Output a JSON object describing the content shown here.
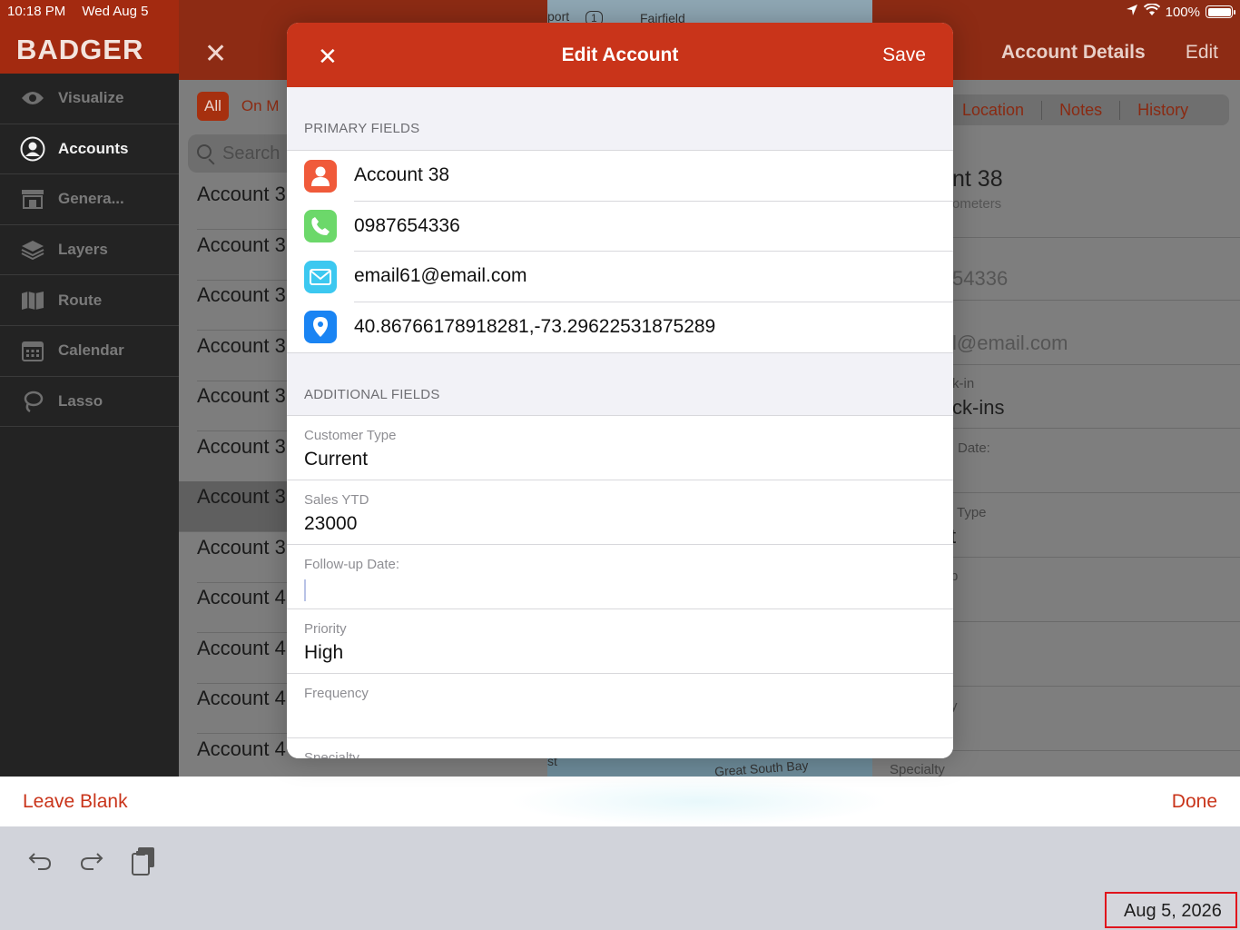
{
  "status_bar": {
    "time": "10:18 PM",
    "date": "Wed Aug 5",
    "battery": "100%"
  },
  "sidebar": {
    "brand": "BADGER",
    "items": [
      {
        "label": "Visualize",
        "icon": "eye-icon"
      },
      {
        "label": "Accounts",
        "icon": "person-circle-icon",
        "active": true
      },
      {
        "label": "Genera...",
        "icon": "storefront-icon"
      },
      {
        "label": "Layers",
        "icon": "layers-icon"
      },
      {
        "label": "Route",
        "icon": "map-icon"
      },
      {
        "label": "Calendar",
        "icon": "calendar-icon"
      },
      {
        "label": "Lasso",
        "icon": "lasso-icon"
      }
    ]
  },
  "account_list": {
    "filter_all": "All",
    "filter_partial": "On M",
    "search_placeholder": "Search",
    "rows": [
      "Account 3",
      "Account 3",
      "Account 3",
      "Account 3",
      "Account 3",
      "Account 3",
      "Account 3",
      "Account 3",
      "Account 4",
      "Account 4",
      "Account 4",
      "Account 4"
    ]
  },
  "map": {
    "label_top_1": "port",
    "label_top_2": "Fairfield",
    "label_top_route": "1",
    "label_bottom_1": "st",
    "label_bottom_2": "Great South Bay"
  },
  "details": {
    "title": "Account Details",
    "edit": "Edit",
    "tabs": [
      "Location",
      "Notes",
      "History"
    ],
    "name_partial": "nt 38",
    "distance_partial": "ometers",
    "phone_partial": "54336",
    "email_partial": "l@email.com",
    "checkin_label_partial": "k-in",
    "checkin_value_partial": "ck-ins",
    "date_label_partial": "Date:",
    "type_label_partial": "Type",
    "type_value_partial": "t",
    "p_partial": "p",
    "y_partial": "y",
    "specialty": "Specialty"
  },
  "modal": {
    "title": "Edit Account",
    "save": "Save",
    "primary_header": "PRIMARY FIELDS",
    "primary_fields": [
      {
        "value": "Account 38",
        "icon": "person-icon",
        "color": "#f05a3a"
      },
      {
        "value": "0987654336",
        "icon": "phone-icon",
        "color": "#6cd86a"
      },
      {
        "value": "email61@email.com",
        "icon": "envelope-icon",
        "color": "#3cc8f0"
      },
      {
        "value": "40.86766178918281,-73.29622531875289",
        "icon": "location-pin-icon",
        "color": "#1a84f3"
      }
    ],
    "additional_header": "ADDITIONAL FIELDS",
    "additional_fields": [
      {
        "label": "Customer Type",
        "value": "Current"
      },
      {
        "label": "Sales YTD",
        "value": "23000"
      },
      {
        "label": "Follow-up Date:",
        "value": ""
      },
      {
        "label": "Priority",
        "value": "High"
      },
      {
        "label": "Frequency",
        "value": ""
      },
      {
        "label": "Specialty",
        "value": ""
      }
    ]
  },
  "keyboard": {
    "leave_blank": "Leave Blank",
    "done": "Done",
    "date_value": "Aug 5, 2026"
  },
  "colors": {
    "accent": "#c9341a",
    "sidebar_bg": "#232323"
  }
}
